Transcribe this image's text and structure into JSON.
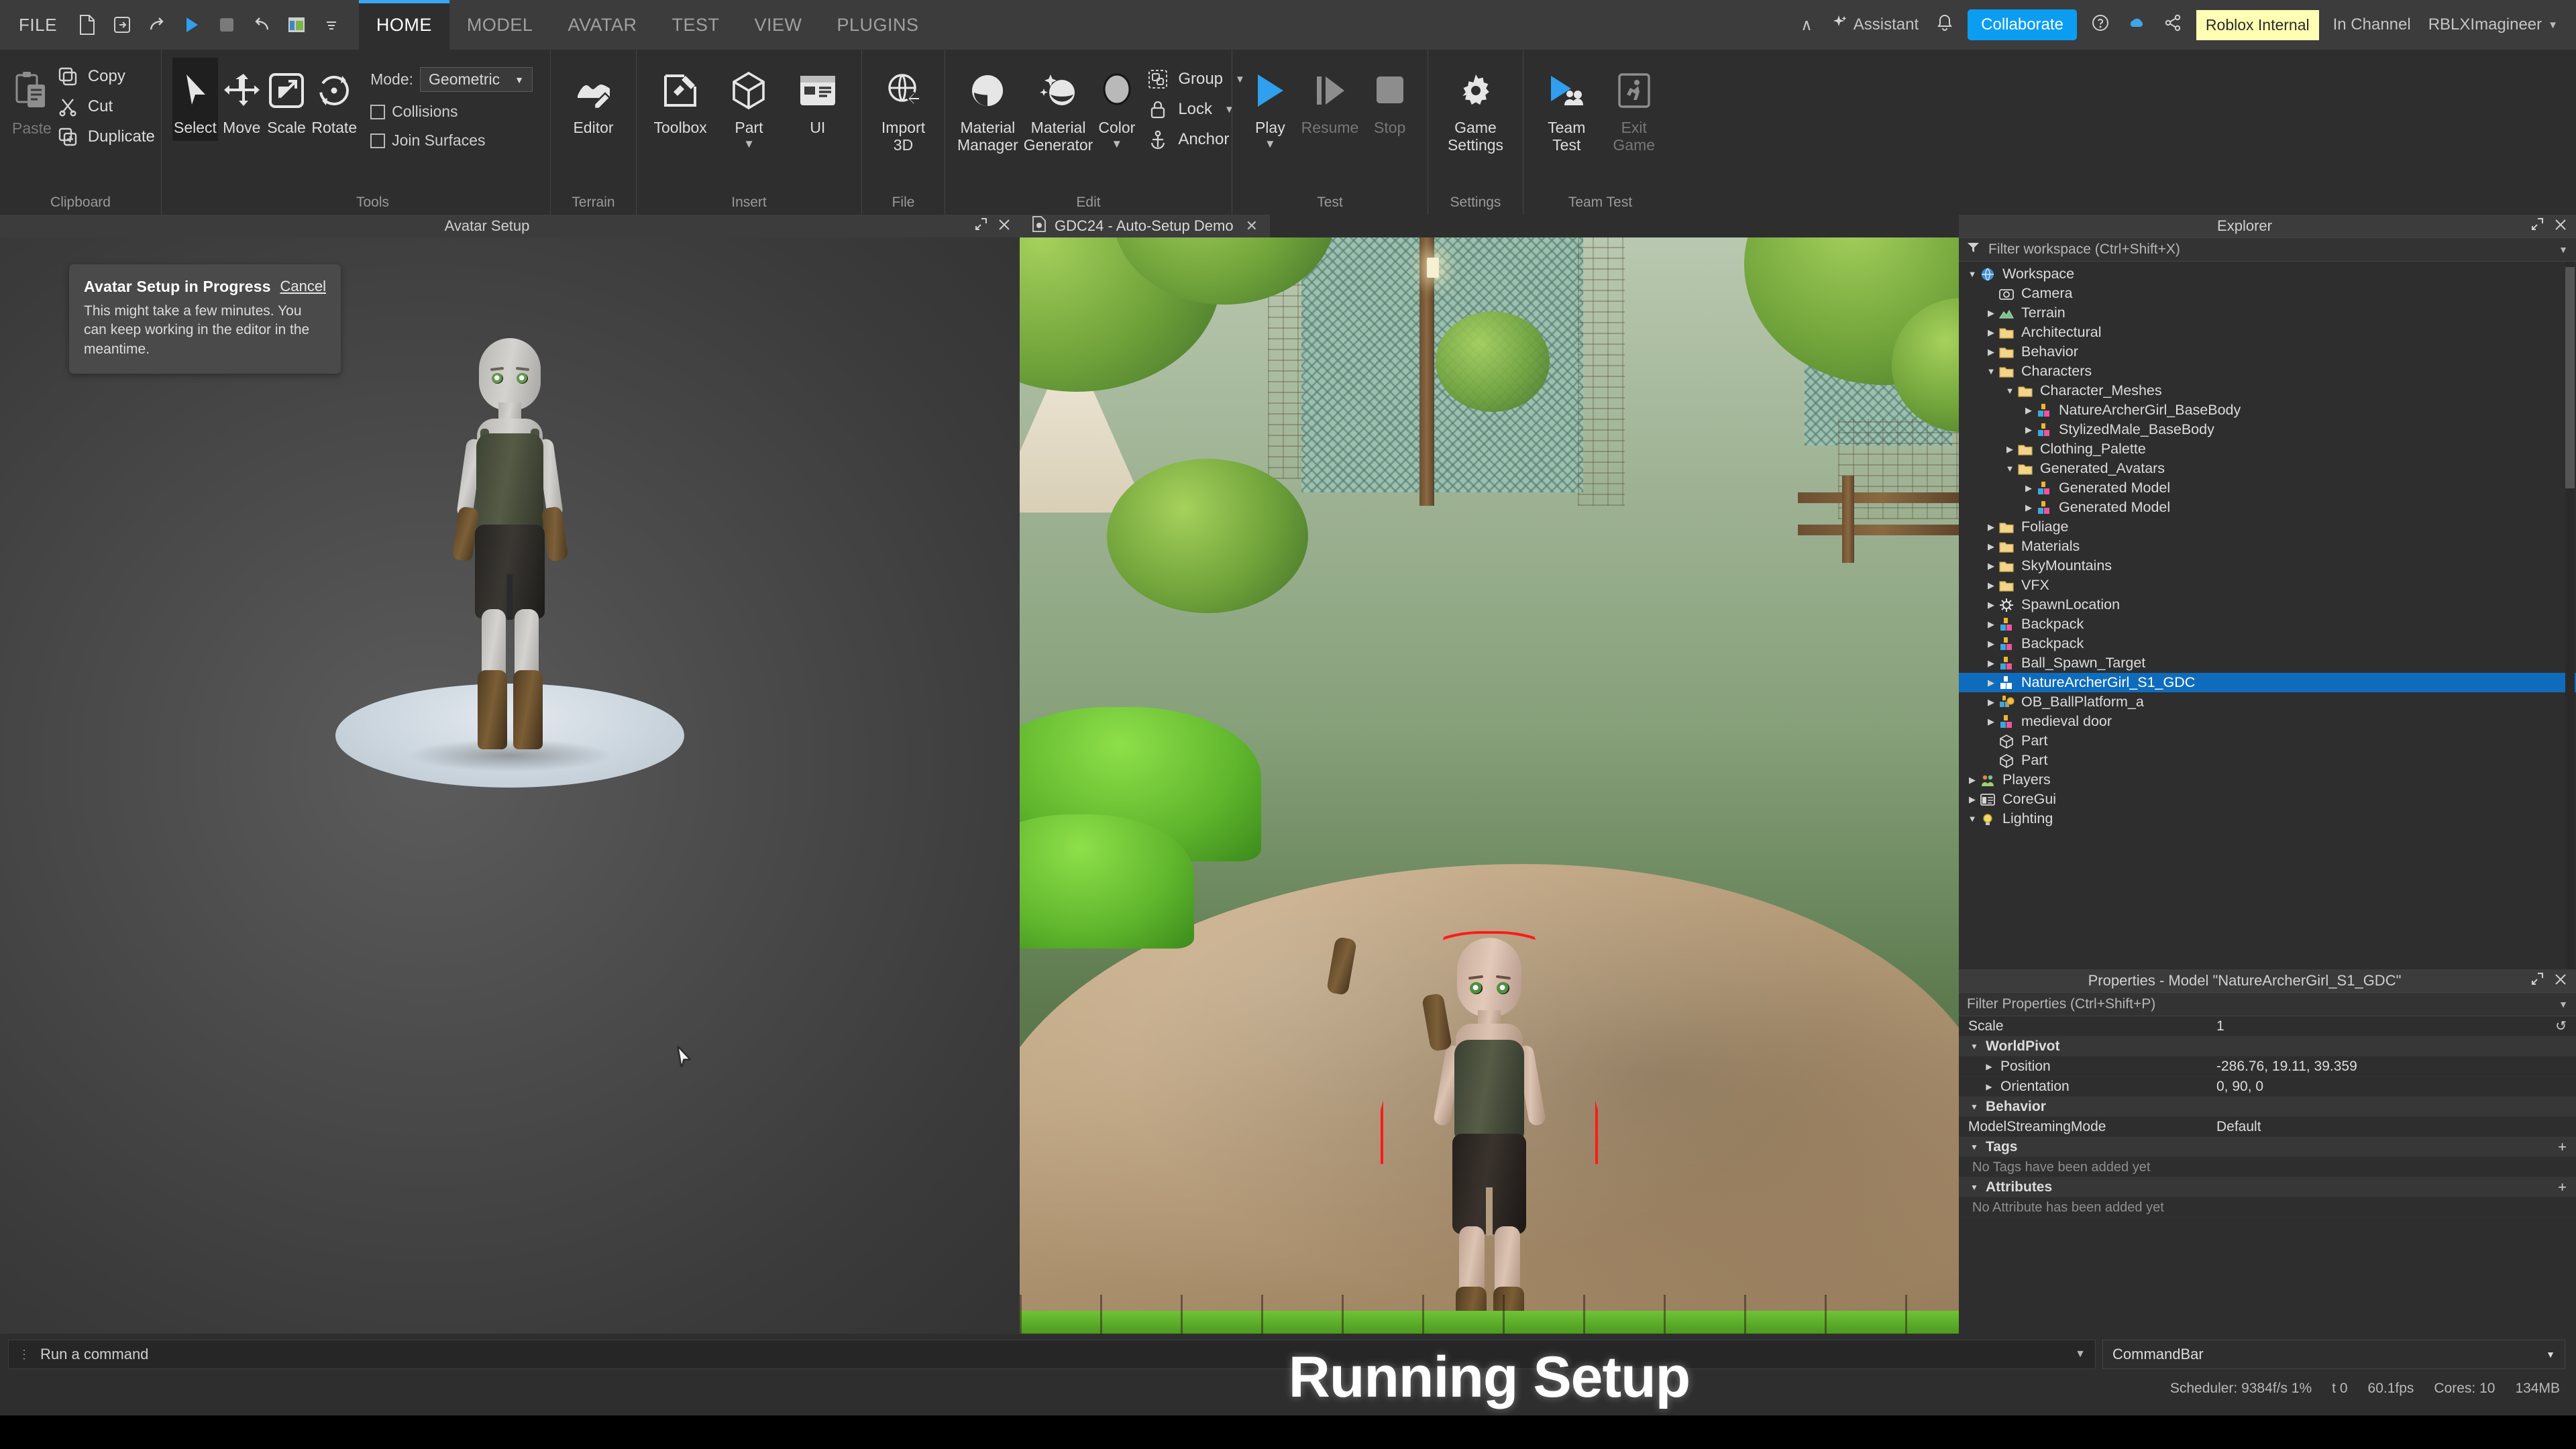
{
  "menubar": {
    "file_label": "FILE",
    "quick_icons": [
      "new-file-icon",
      "export-icon",
      "redo-icon",
      "play-icon",
      "stop-icon",
      "undo-icon",
      "studio-window-icon",
      "more-caret-icon"
    ],
    "tabs": [
      {
        "label": "HOME",
        "active": true
      },
      {
        "label": "MODEL",
        "active": false
      },
      {
        "label": "AVATAR",
        "active": false
      },
      {
        "label": "TEST",
        "active": false
      },
      {
        "label": "VIEW",
        "active": false
      },
      {
        "label": "PLUGINS",
        "active": false
      }
    ],
    "right": {
      "chevron": "∧",
      "assistant_label": "Assistant",
      "collaborate_label": "Collaborate",
      "roblox_internal_label": "Roblox Internal",
      "in_channel_label": "In Channel",
      "user_label": "RBLXImagineer"
    }
  },
  "ribbon": {
    "groups": [
      {
        "name": "Clipboard",
        "label": "Clipboard",
        "paste_label": "Paste",
        "items": [
          {
            "label": "Copy",
            "icon": "copy-icon"
          },
          {
            "label": "Cut",
            "icon": "cut-icon"
          },
          {
            "label": "Duplicate",
            "icon": "duplicate-icon"
          }
        ]
      },
      {
        "name": "Tools",
        "label": "Tools",
        "buttons": [
          {
            "label": "Select",
            "icon": "cursor-icon",
            "selected": true
          },
          {
            "label": "Move",
            "icon": "move-arrows-icon",
            "selected": false
          },
          {
            "label": "Scale",
            "icon": "scale-icon",
            "selected": false
          },
          {
            "label": "Rotate",
            "icon": "rotate-icon",
            "selected": false
          }
        ],
        "mode_label": "Mode:",
        "mode_value": "Geometric",
        "checkboxes": [
          {
            "label": "Collisions",
            "checked": false
          },
          {
            "label": "Join Surfaces",
            "checked": false
          }
        ]
      },
      {
        "name": "Terrain",
        "label": "Terrain",
        "buttons": [
          {
            "label": "Editor",
            "icon": "terrain-editor-icon"
          }
        ]
      },
      {
        "name": "Insert",
        "label": "Insert",
        "buttons": [
          {
            "label": "Toolbox",
            "icon": "toolbox-icon"
          },
          {
            "label": "Part",
            "icon": "part-cube-icon",
            "has_caret": true
          },
          {
            "label": "UI",
            "icon": "ui-panel-icon"
          }
        ]
      },
      {
        "name": "File",
        "label": "File",
        "buttons": [
          {
            "label": "Import\n3D",
            "line1": "Import",
            "line2": "3D",
            "icon": "import-3d-icon"
          }
        ]
      },
      {
        "name": "Edit",
        "label": "Edit",
        "buttons": [
          {
            "line1": "Material",
            "line2": "Manager",
            "icon": "material-manager-icon"
          },
          {
            "line1": "Material",
            "line2": "Generator",
            "icon": "material-generator-icon"
          },
          {
            "line1": "Color",
            "line2": "",
            "icon": "color-swatch-icon",
            "has_caret": true
          }
        ],
        "items": [
          {
            "label": "Group",
            "icon": "group-icon",
            "has_caret": true
          },
          {
            "label": "Lock",
            "icon": "lock-icon",
            "has_caret": true
          },
          {
            "label": "Anchor",
            "icon": "anchor-icon",
            "has_caret": false
          }
        ]
      },
      {
        "name": "Test",
        "label": "Test",
        "buttons": [
          {
            "label": "Play",
            "icon": "play-icon",
            "has_caret": true,
            "enabled": true
          },
          {
            "label": "Resume",
            "icon": "resume-icon",
            "enabled": false
          },
          {
            "label": "Stop",
            "icon": "stop-icon",
            "enabled": false
          }
        ]
      },
      {
        "name": "Settings",
        "label": "Settings",
        "buttons": [
          {
            "line1": "Game",
            "line2": "Settings",
            "icon": "gear-icon"
          }
        ]
      },
      {
        "name": "TeamTest",
        "label": "Team Test",
        "buttons": [
          {
            "line1": "Team",
            "line2": "Test",
            "icon": "team-test-icon",
            "enabled": true
          },
          {
            "line1": "Exit",
            "line2": "Game",
            "icon": "exit-game-icon",
            "enabled": false
          }
        ]
      }
    ]
  },
  "avatar_panel": {
    "title": "Avatar Setup",
    "card": {
      "title": "Avatar Setup in Progress",
      "cancel_label": "Cancel",
      "body": "This might take a few minutes. You can keep working in the editor in the meantime."
    }
  },
  "viewport": {
    "tab_label": "GDC24 - Auto-Setup Demo",
    "tab_close": "✕",
    "overlay_text": "Running Setup"
  },
  "explorer": {
    "title": "Explorer",
    "filter_placeholder": "Filter workspace (Ctrl+Shift+X)",
    "tree": [
      {
        "label": "Workspace",
        "depth": 0,
        "icon": "workspace-icon",
        "arrow": "down",
        "selected": false
      },
      {
        "label": "Camera",
        "depth": 1,
        "icon": "camera-icon",
        "arrow": "none",
        "selected": false
      },
      {
        "label": "Terrain",
        "depth": 1,
        "icon": "terrain-icon",
        "arrow": "right",
        "selected": false
      },
      {
        "label": "Architectural",
        "depth": 1,
        "icon": "folder-icon",
        "arrow": "right",
        "selected": false
      },
      {
        "label": "Behavior",
        "depth": 1,
        "icon": "folder-icon",
        "arrow": "right",
        "selected": false
      },
      {
        "label": "Characters",
        "depth": 1,
        "icon": "folder-icon",
        "arrow": "down",
        "selected": false
      },
      {
        "label": "Character_Meshes",
        "depth": 2,
        "icon": "folder-icon",
        "arrow": "down",
        "selected": false
      },
      {
        "label": "NatureArcherGirl_BaseBody",
        "depth": 3,
        "icon": "model-icon",
        "arrow": "right",
        "selected": false
      },
      {
        "label": "StylizedMale_BaseBody",
        "depth": 3,
        "icon": "model-icon",
        "arrow": "right",
        "selected": false
      },
      {
        "label": "Clothing_Palette",
        "depth": 2,
        "icon": "folder-icon",
        "arrow": "right",
        "selected": false
      },
      {
        "label": "Generated_Avatars",
        "depth": 2,
        "icon": "folder-icon",
        "arrow": "down",
        "selected": false
      },
      {
        "label": "Generated Model",
        "depth": 3,
        "icon": "model-icon",
        "arrow": "right",
        "selected": false
      },
      {
        "label": "Generated Model",
        "depth": 3,
        "icon": "model-icon",
        "arrow": "right",
        "selected": false
      },
      {
        "label": "Foliage",
        "depth": 1,
        "icon": "folder-icon",
        "arrow": "right",
        "selected": false
      },
      {
        "label": "Materials",
        "depth": 1,
        "icon": "folder-icon",
        "arrow": "right",
        "selected": false
      },
      {
        "label": "SkyMountains",
        "depth": 1,
        "icon": "folder-icon",
        "arrow": "right",
        "selected": false
      },
      {
        "label": "VFX",
        "depth": 1,
        "icon": "folder-icon",
        "arrow": "right",
        "selected": false
      },
      {
        "label": "SpawnLocation",
        "depth": 1,
        "icon": "spawn-icon",
        "arrow": "right",
        "selected": false
      },
      {
        "label": "Backpack",
        "depth": 1,
        "icon": "model-icon",
        "arrow": "right",
        "selected": false
      },
      {
        "label": "Backpack",
        "depth": 1,
        "icon": "model-icon",
        "arrow": "right",
        "selected": false
      },
      {
        "label": "Ball_Spawn_Target",
        "depth": 1,
        "icon": "model-icon",
        "arrow": "right",
        "selected": false
      },
      {
        "label": "NatureArcherGirl_S1_GDC",
        "depth": 1,
        "icon": "model-sel-icon",
        "arrow": "right",
        "selected": true
      },
      {
        "label": "OB_BallPlatform_a",
        "depth": 1,
        "icon": "model-ball-icon",
        "arrow": "right",
        "selected": false
      },
      {
        "label": "medieval door",
        "depth": 1,
        "icon": "model-icon",
        "arrow": "right",
        "selected": false
      },
      {
        "label": "Part",
        "depth": 1,
        "icon": "part-cube-icon",
        "arrow": "none",
        "selected": false
      },
      {
        "label": "Part",
        "depth": 1,
        "icon": "part-cube-icon",
        "arrow": "none",
        "selected": false
      },
      {
        "label": "Players",
        "depth": 0,
        "icon": "players-icon",
        "arrow": "right",
        "selected": false
      },
      {
        "label": "CoreGui",
        "depth": 0,
        "icon": "coregui-icon",
        "arrow": "right",
        "selected": false
      },
      {
        "label": "Lighting",
        "depth": 0,
        "icon": "lighting-icon",
        "arrow": "down",
        "selected": false
      }
    ]
  },
  "properties": {
    "title": "Properties - Model \"NatureArcherGirl_S1_GDC\"",
    "filter_placeholder": "Filter Properties (Ctrl+Shift+P)",
    "rows": [
      {
        "kind": "prop",
        "name": "Scale",
        "value": "1",
        "indent": 0,
        "revert": true
      },
      {
        "kind": "section",
        "name": "WorldPivot",
        "value": "",
        "indent": 0,
        "twisty": "down"
      },
      {
        "kind": "prop",
        "name": "Position",
        "value": "-286.76, 19.11, 39.359",
        "indent": 1,
        "twisty": "right"
      },
      {
        "kind": "prop",
        "name": "Orientation",
        "value": "0, 90, 0",
        "indent": 1,
        "twisty": "right"
      },
      {
        "kind": "section",
        "name": "Behavior",
        "value": "",
        "indent": 0,
        "twisty": "down"
      },
      {
        "kind": "prop",
        "name": "ModelStreamingMode",
        "value": "Default",
        "indent": 0
      },
      {
        "kind": "section",
        "name": "Tags",
        "value": "",
        "indent": 0,
        "twisty": "down",
        "plus": "+"
      },
      {
        "kind": "note",
        "name": "No Tags have been added yet",
        "value": ""
      },
      {
        "kind": "section",
        "name": "Attributes",
        "value": "",
        "indent": 0,
        "twisty": "down",
        "plus": "+"
      },
      {
        "kind": "note",
        "name": "No Attribute has been added yet",
        "value": ""
      }
    ]
  },
  "commandbar": {
    "placeholder": "Run a command",
    "select_value": "CommandBar"
  },
  "statusbar": {
    "scheduler": "Scheduler: 9384f/s 1%",
    "t": "t 0",
    "fps": "60.1fps",
    "cores": "Cores: 10",
    "memory": "134MB"
  }
}
